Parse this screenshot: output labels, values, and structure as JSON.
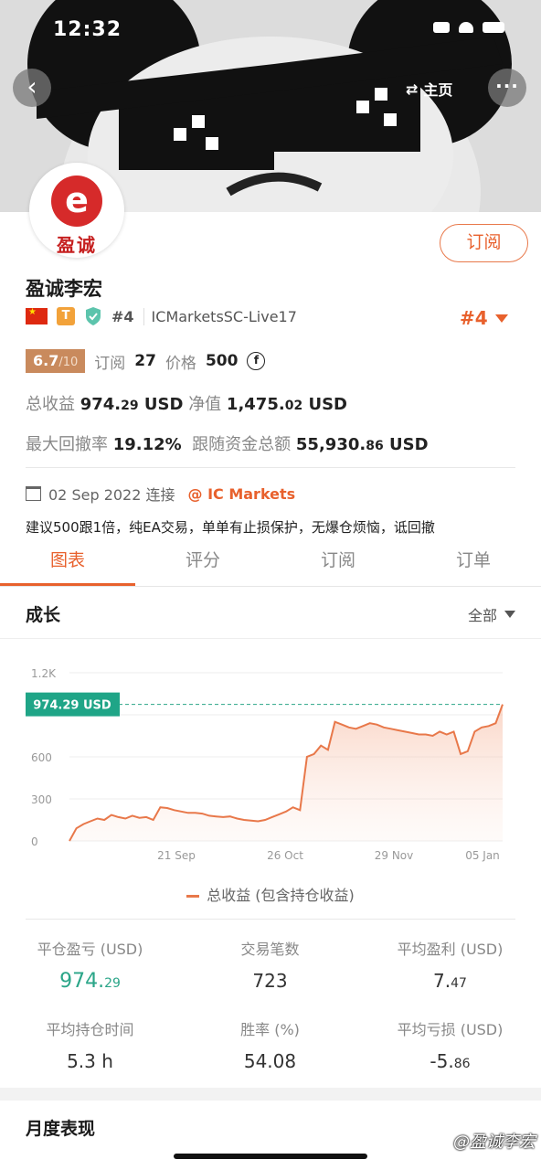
{
  "status_bar": {
    "time": "12:32"
  },
  "header": {
    "home_label": "主页",
    "back_icon": "chevron-left-icon",
    "more_icon": "more-dots-icon"
  },
  "profile": {
    "avatar_text": "盈诚",
    "avatar_letter": "e",
    "name": "盈诚李宏",
    "subscribe_label": "订阅",
    "rank_small": "#4",
    "account": "ICMarketsSC-Live17",
    "rank_big": "#4",
    "badge_letter": "T"
  },
  "score": {
    "value": "6.7",
    "max": "/10",
    "subscribe_label": "订阅",
    "subscribe_count": "27",
    "price_label": "价格",
    "price_value": "500",
    "coin_symbol": "f"
  },
  "stats": {
    "total_profit_label": "总收益",
    "total_profit_int": "974.",
    "total_profit_dec": "29",
    "total_profit_unit": "USD",
    "equity_label": "净值",
    "equity_int": "1,475.",
    "equity_dec": "02",
    "equity_unit": "USD",
    "drawdown_label": "最大回撤率",
    "drawdown_value": "19.12%",
    "follow_label": "跟随资金总额",
    "follow_int": "55,930.",
    "follow_dec": "86",
    "follow_unit": "USD"
  },
  "connect": {
    "date": "02 Sep 2022 连接",
    "broker": "@ IC Markets"
  },
  "description": "建议500跟1倍，纯EA交易，单单有止损保护，无爆仓烦恼，诋回撤",
  "tabs": [
    {
      "label": "图表",
      "active": true
    },
    {
      "label": "评分"
    },
    {
      "label": "订阅"
    },
    {
      "label": "订单"
    }
  ],
  "growth": {
    "title": "成长",
    "filter": "全部"
  },
  "chart_data": {
    "type": "area",
    "ylabel": "",
    "xlabel": "",
    "y_ticks": [
      "0",
      "300",
      "600",
      "",
      "1.2K"
    ],
    "y_tick_values": [
      0,
      300,
      600,
      900,
      1200
    ],
    "ylim": [
      0,
      1200
    ],
    "x_tick_labels": [
      "21 Sep",
      "26 Oct",
      "29 Nov",
      "05 Jan"
    ],
    "current_label": "974.29 USD",
    "current_value": 974.29,
    "series": [
      {
        "name": "总收益 (包含持仓收益)",
        "color": "#e8784a",
        "values": [
          0,
          90,
          120,
          140,
          160,
          150,
          185,
          170,
          160,
          180,
          165,
          170,
          150,
          240,
          235,
          220,
          210,
          200,
          200,
          195,
          180,
          175,
          170,
          175,
          160,
          150,
          145,
          140,
          150,
          170,
          190,
          210,
          240,
          220,
          600,
          620,
          680,
          650,
          850,
          830,
          810,
          800,
          820,
          840,
          830,
          810,
          800,
          790,
          780,
          770,
          760,
          760,
          750,
          780,
          760,
          780,
          620,
          640,
          780,
          810,
          820,
          840,
          974.29
        ]
      }
    ]
  },
  "legend_label": "总收益 (包含持仓收益)",
  "metrics": {
    "closed_pl_label": "平仓盈亏 (USD)",
    "closed_pl_int": "974.",
    "closed_pl_dec": "29",
    "trades_label": "交易笔数",
    "trades_value": "723",
    "avg_profit_label": "平均盈利 (USD)",
    "avg_profit_int": "7.",
    "avg_profit_dec": "47",
    "hold_time_label": "平均持仓时间",
    "hold_time_value": "5.3 h",
    "winrate_label": "胜率 (%)",
    "winrate_value": "54.08",
    "avg_loss_label": "平均亏损 (USD)",
    "avg_loss_int": "-5.",
    "avg_loss_dec": "86"
  },
  "monthly_title": "月度表现",
  "watermark": "@盈诚李宏"
}
